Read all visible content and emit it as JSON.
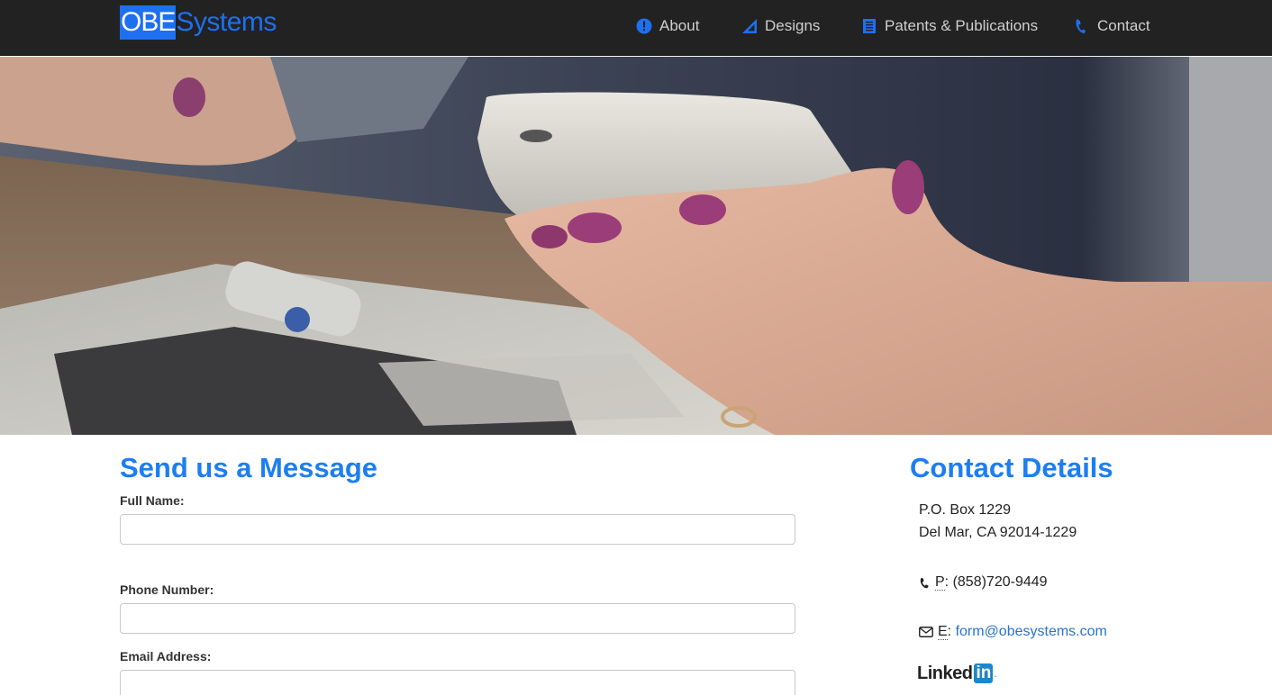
{
  "brand": {
    "part1": "OBE",
    "part2": "Systems"
  },
  "nav": {
    "items": [
      {
        "label": "About",
        "icon": "info-circle-icon"
      },
      {
        "label": "Designs",
        "icon": "ruler-triangle-icon"
      },
      {
        "label": "Patents & Publications",
        "icon": "document-icon"
      },
      {
        "label": "Contact",
        "icon": "phone-icon"
      }
    ]
  },
  "colors": {
    "accent": "#1d7ef0",
    "navbar": "#222222",
    "link": "#2a74c9"
  },
  "form": {
    "heading": "Send us a Message",
    "full_name_label": "Full Name:",
    "full_name_value": "",
    "phone_label": "Phone Number:",
    "phone_value": "",
    "email_label": "Email Address:",
    "email_value": ""
  },
  "contact": {
    "heading": "Contact Details",
    "address_line1": "P.O. Box 1229",
    "address_line2": "Del Mar, CA 92014-1229",
    "phone_prefix": "P",
    "phone_value": ": (858)720-9449",
    "email_prefix": "E",
    "email_value": "form@obesystems.com",
    "linkedin_text": "Linked",
    "linkedin_box": "in",
    "linkedin_dot": "."
  }
}
